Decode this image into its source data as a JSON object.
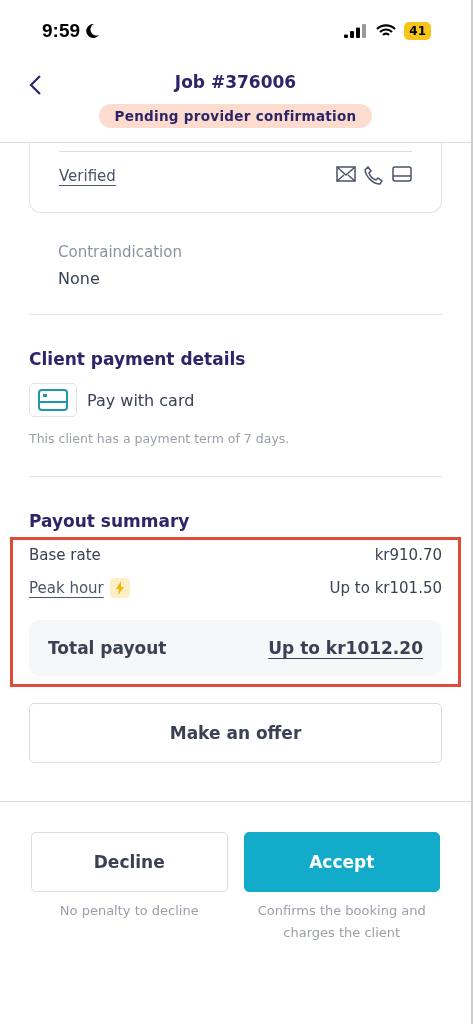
{
  "status_bar": {
    "time": "9:59",
    "battery": "41"
  },
  "header": {
    "title": "Job #376006",
    "status": "Pending provider confirmation"
  },
  "contact_card": {
    "verification": "Verified"
  },
  "contraindication": {
    "label": "Contraindication",
    "value": "None"
  },
  "client_payment": {
    "title": "Client payment details",
    "method": "Pay with card",
    "note": "This client has a payment term of 7 days."
  },
  "payout_summary": {
    "title": "Payout summary",
    "highlighted": true,
    "rows": [
      {
        "label": "Base rate",
        "value": "kr910.70",
        "kind": "plain"
      },
      {
        "label": "Peak hour",
        "value": "Up to kr101.50",
        "kind": "peak"
      }
    ],
    "total": {
      "label": "Total payout",
      "value": "Up to kr1012.20"
    }
  },
  "offer_button": "Make an offer",
  "actions": [
    {
      "label": "Decline",
      "caption": "No penalty to decline",
      "kind": "secondary"
    },
    {
      "label": "Accept",
      "caption": "Confirms the booking and charges the client",
      "kind": "primary"
    }
  ]
}
